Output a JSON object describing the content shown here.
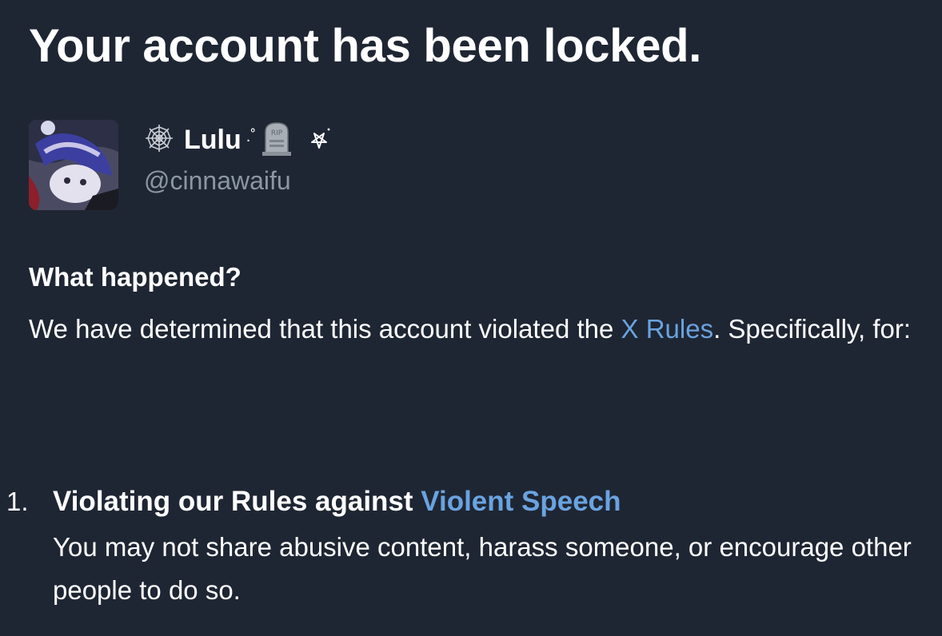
{
  "page": {
    "title": "Your account has been locked."
  },
  "account": {
    "display_name": "Lulu",
    "name_sparkle": ".˚",
    "handle": "@cinnawaifu",
    "name_decorations": [
      "spider-web-icon",
      "headstone-icon",
      "pentagram-icon"
    ]
  },
  "what_happened": {
    "heading": "What happened?",
    "body_before_link": "We have determined that this account violated the ",
    "rules_link": "X Rules",
    "body_after_link": ". Specifically, for:"
  },
  "violations": [
    {
      "number": "1.",
      "title_prefix": "Violating our Rules against ",
      "title_link": "Violent Speech",
      "description": "You may not share abusive content, harass someone, or encourage other people to do so."
    }
  ],
  "colors": {
    "background": "#1f2633",
    "text": "#ffffff",
    "muted": "#8b96a5",
    "link": "#6aa3e0"
  }
}
